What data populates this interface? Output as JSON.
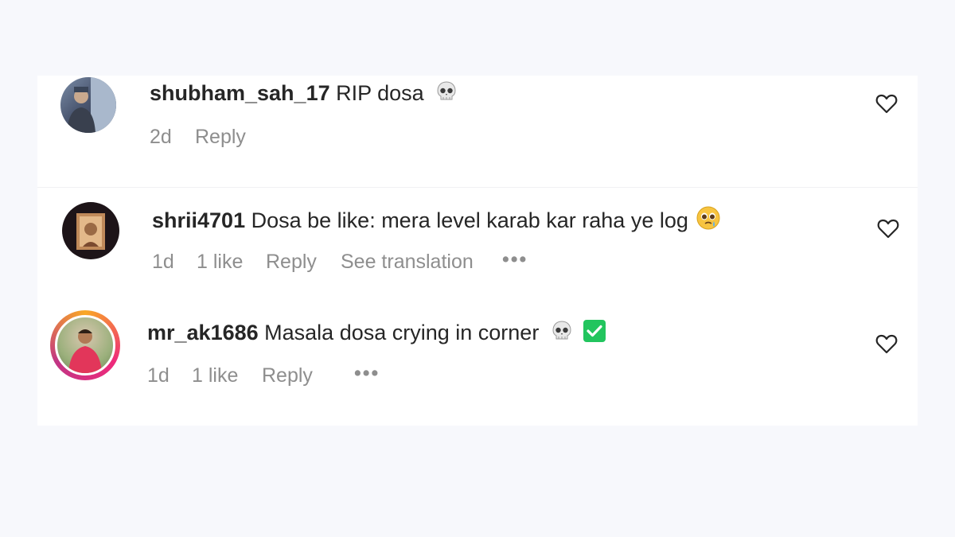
{
  "comments": [
    {
      "username": "shubham_sah_17",
      "text": "RIP dosa",
      "emojis": [
        "skull-emoji"
      ],
      "time": "2d",
      "likes": "",
      "reply_label": "Reply",
      "translation_label": "",
      "more_label": ""
    },
    {
      "username": "shrii4701",
      "text": "Dosa be like: mera level karab kar raha ye log",
      "emojis": [
        "pleading-face-emoji"
      ],
      "time": "1d",
      "likes": "1 like",
      "reply_label": "Reply",
      "translation_label": "See translation",
      "more_label": "•••"
    },
    {
      "username": "mr_ak1686",
      "text": "Masala dosa crying in corner",
      "emojis": [
        "skull-emoji",
        "check-mark-emoji"
      ],
      "time": "1d",
      "likes": "1 like",
      "reply_label": "Reply",
      "translation_label": "",
      "more_label": "•••"
    }
  ],
  "colors": {
    "text": "#262626",
    "meta": "#8e8e8e",
    "background": "#f7f8fc",
    "panel": "#ffffff",
    "check": "#22c55e"
  }
}
